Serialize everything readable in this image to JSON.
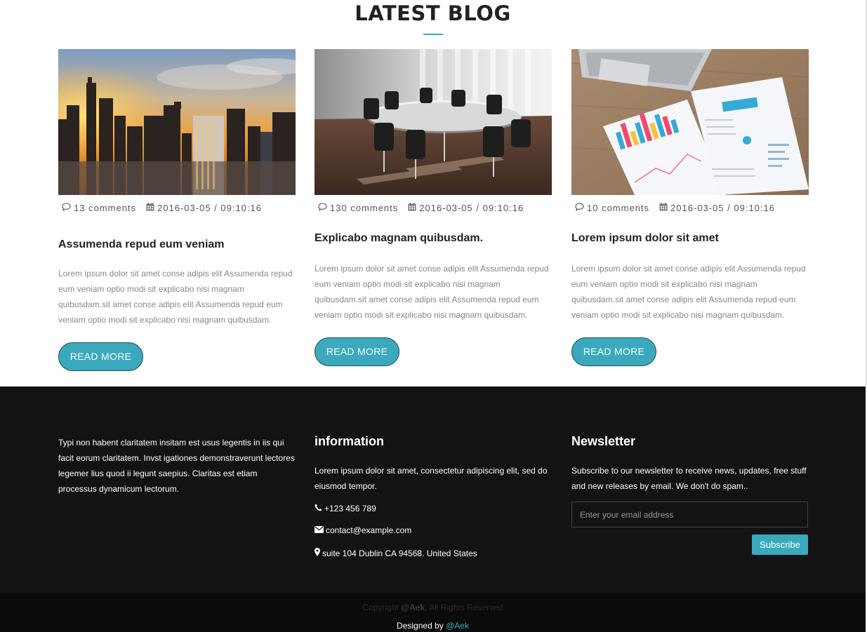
{
  "blog": {
    "title": "LATEST BLOG",
    "accent_color": "#3aa9bd",
    "posts": [
      {
        "image": "city-skyline-sunset-image",
        "comments": "13 comments",
        "date": "2016-03-05 / 09:10:16",
        "heading": "Assumenda repud eum veniam",
        "text": "Lorem ipsum dolor sit amet conse adipis elit Assumenda repud eum veniam optio modi sit explicabo nisi magnam quibusdam.sit amet conse adipis elit Assumenda repud eum veniam optio modi sit explicabo nisi magnam quibusdam.",
        "button": "READ MORE"
      },
      {
        "image": "conference-room-image",
        "comments": "130 comments",
        "date": "2016-03-05 / 09:10:16",
        "heading": "Explicabo magnam quibusdam.",
        "text": "Lorem ipsum dolor sit amet conse adipis elit Assumenda repud eum veniam optio modi sit explicabo nisi magnam quibusdam.sit amet conse adipis elit Assumenda repud eum veniam optio modi sit explicabo nisi magnam quibusdam.",
        "button": "READ MORE"
      },
      {
        "image": "laptop-charts-image",
        "comments": "10 comments",
        "date": "2016-03-05 / 09:10:16",
        "heading": "Lorem ipsum dolor sit amet",
        "text": "Lorem ipsum dolor sit amet conse adipis elit Assumenda repud eum veniam optio modi sit explicabo nisi magnam quibusdam.sit amet conse adipis elit Assumenda repud eum veniam optio modi sit explicabo nisi magnam quibusdam.",
        "button": "READ MORE"
      }
    ]
  },
  "footer": {
    "about": "Typi non habent claritatem insitam est usus legentis in iis qui facit eorum claritatem. Invst igationes demonstraverunt lectores legemer lius quod ii legunt saepius. Claritas est etiam processus dynamicum lectorum.",
    "information": {
      "heading": "information",
      "text": "Lorem ipsum dolor sit amet, consectetur adipiscing elit, sed do eiusmod tempor.",
      "phone": "+123 456 789",
      "email": "contact@example.com",
      "address": "suite 104 Dublin CA 94568. United States"
    },
    "newsletter": {
      "heading": "Newsletter",
      "text": "Subscribe to our newsletter to receive news, updates, free stuff and new releases by email. We don't do spam..",
      "placeholder": "Enter your email address",
      "button": "Subscribe"
    },
    "copyright_prefix": "Copyright ",
    "copyright_brand": "@Aek",
    "copyright_suffix": ". All Rights Reserved",
    "designed_prefix": "Designed by ",
    "designed_link": "@Aek"
  }
}
